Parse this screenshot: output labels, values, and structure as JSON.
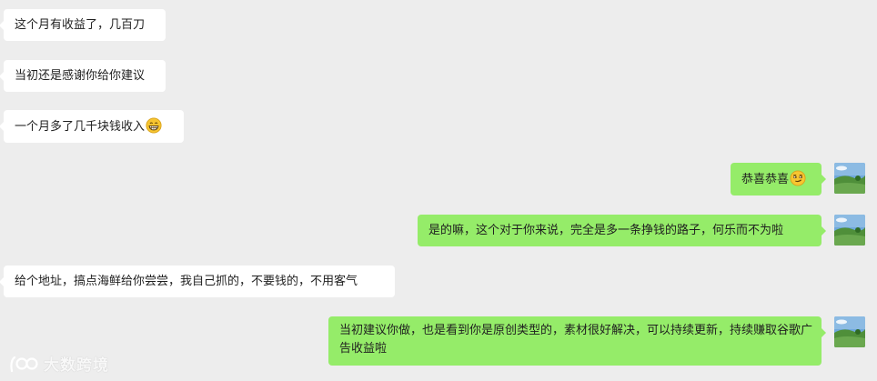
{
  "chat": {
    "messages": [
      {
        "side": "left",
        "text": "这个月有收益了，几百刀"
      },
      {
        "side": "left",
        "text": "当初还是感谢你给你建议"
      },
      {
        "side": "left",
        "text": "一个月多了几千块钱收入",
        "emoji": "grin-emoji"
      },
      {
        "side": "right",
        "text": "恭喜恭喜",
        "emoji": "smirk-emoji"
      },
      {
        "side": "right",
        "text": "是的嘛，这个对于你来说，完全是多一条挣钱的路子，何乐而不为啦"
      },
      {
        "side": "left",
        "text": "给个地址，搞点海鲜给你尝尝，我自己抓的，不要钱的，不用客气"
      },
      {
        "side": "right",
        "text": "当初建议你做，也是看到你是原创类型的，素材很好解决，可以持续更新，持续赚取谷歌广告收益啦"
      }
    ]
  },
  "watermark": {
    "text": "大数跨境"
  },
  "colors": {
    "background": "#ededed",
    "incoming_bubble": "#ffffff",
    "outgoing_bubble": "#95ec69"
  }
}
